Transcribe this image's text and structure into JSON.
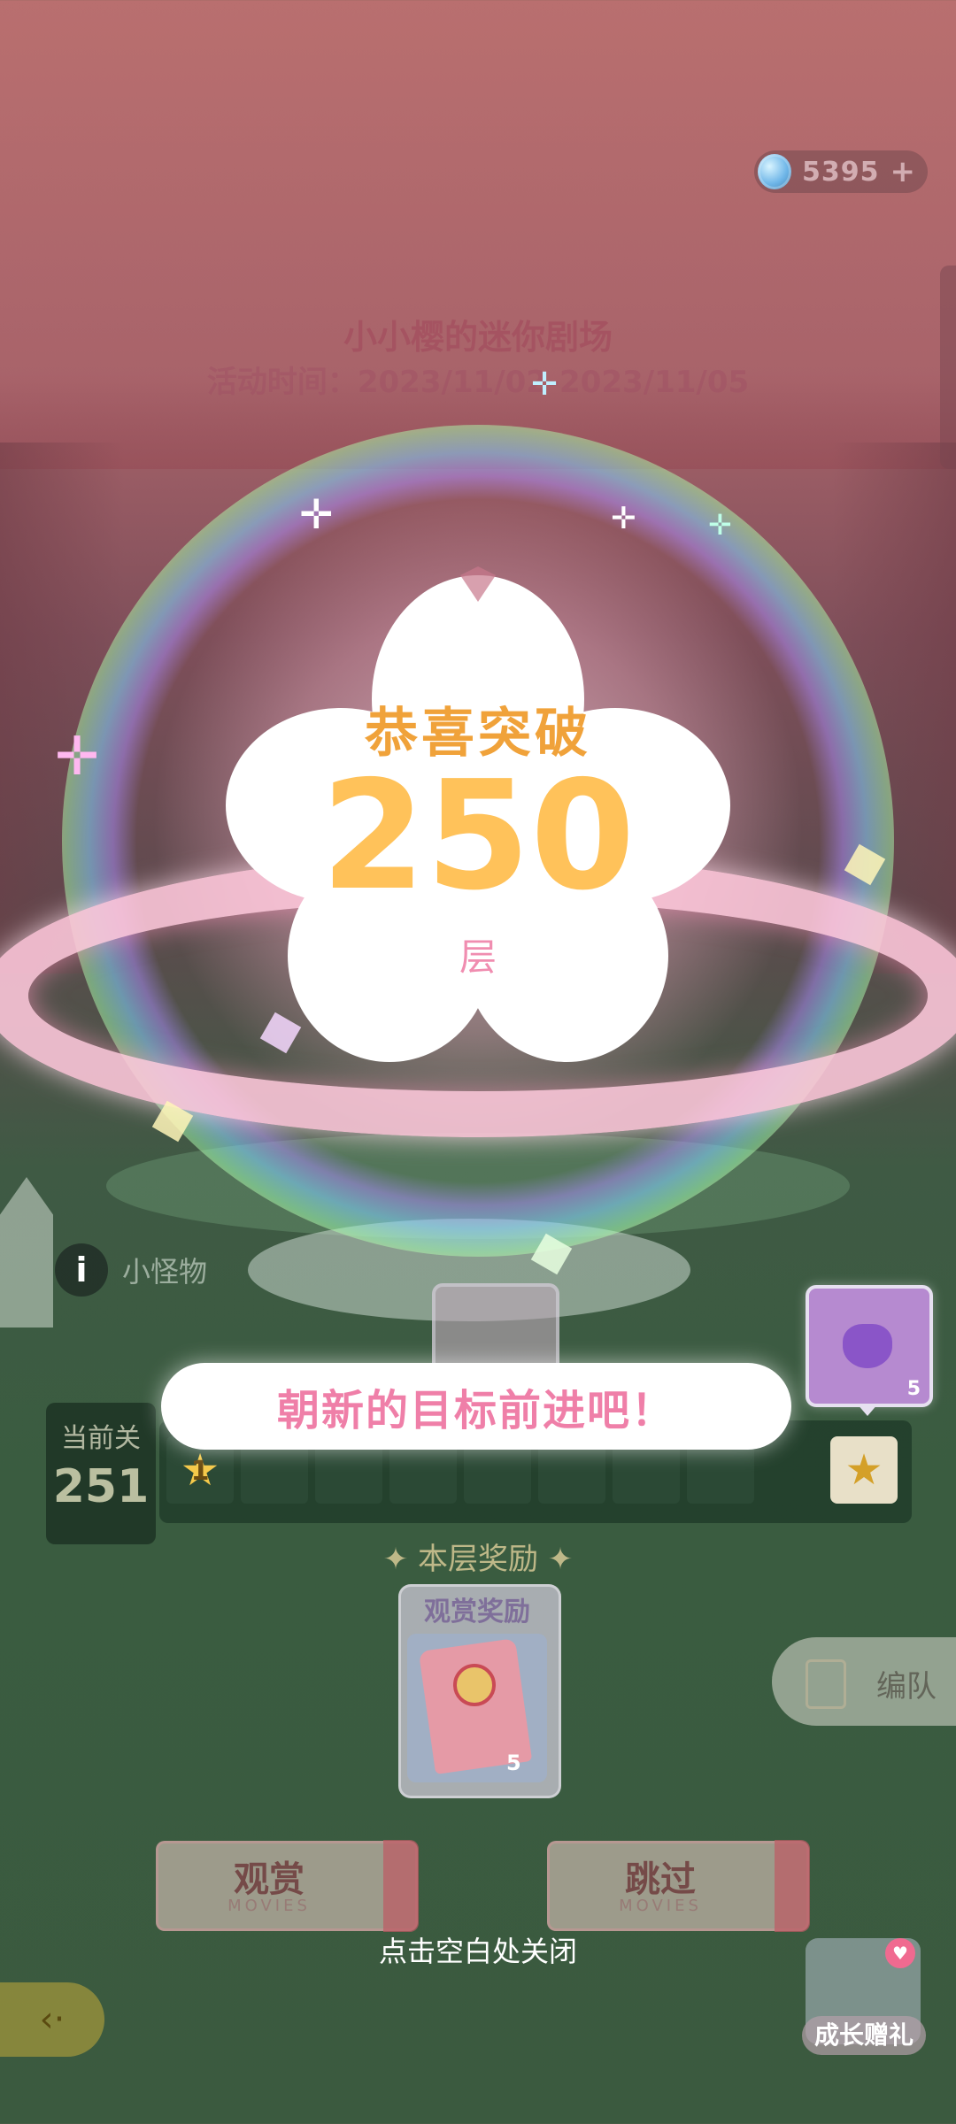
{
  "header": {
    "currency_value": "5395",
    "currency_plus": "+"
  },
  "event": {
    "title": "小小樱的迷你剧场",
    "time": "活动时间：2023/11/02-2023/11/05"
  },
  "popup": {
    "headline": "恭喜突破",
    "floor_number": "250",
    "floor_unit": "层",
    "banner": "朝新的目标前进吧！"
  },
  "monster": {
    "info_glyph": "i",
    "label": "小怪物"
  },
  "progress": {
    "current_label": "当前关",
    "current_value": "251",
    "first_slot_number": "1",
    "reward_count": "5"
  },
  "reward": {
    "section_title": "✦ 本层奖励 ✦",
    "card_label": "观赏奖励",
    "count": "5"
  },
  "team": {
    "label": "编队"
  },
  "tickets": [
    {
      "main": "观赏",
      "sub": "MOVIES"
    },
    {
      "main": "跳过",
      "sub": "MOVIES"
    }
  ],
  "close_hint": "点击空白处关闭",
  "gift": {
    "label": "成长赠礼"
  },
  "colors": {
    "accent_orange": "#f0a23a",
    "number_yellow": "#ffc25a",
    "banner_pink": "#ef7fa8"
  },
  "icons": {
    "gem": "gem-icon",
    "back": "back-arrow-icon",
    "star": "star-icon",
    "info": "info-icon",
    "team": "team-card-icon",
    "gift": "gift-icon"
  }
}
